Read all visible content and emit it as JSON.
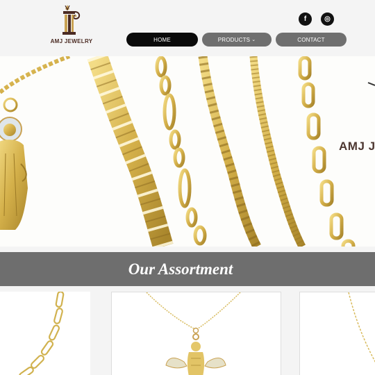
{
  "brand": {
    "logo_text": "AMJ JEWELRY",
    "colors": {
      "logo_brown": "#4a2a22",
      "logo_gold": "#c9a253",
      "nav_active": "#0a0a0a",
      "nav_inactive": "#6f6f6f"
    }
  },
  "social": {
    "facebook_icon": "f",
    "instagram_icon": "◎"
  },
  "nav": {
    "home": "HOME",
    "products": "PRODUCTS",
    "products_chevron": "⌄",
    "contact": "CONTACT"
  },
  "hero": {
    "brand_text": "AMJ J"
  },
  "assortment": {
    "title": "Our Assortment"
  },
  "products": {
    "items": [
      {
        "icon": "paperclip-chain-image"
      },
      {
        "icon": "angel-pendant-image"
      },
      {
        "icon": "chain-image"
      }
    ]
  }
}
